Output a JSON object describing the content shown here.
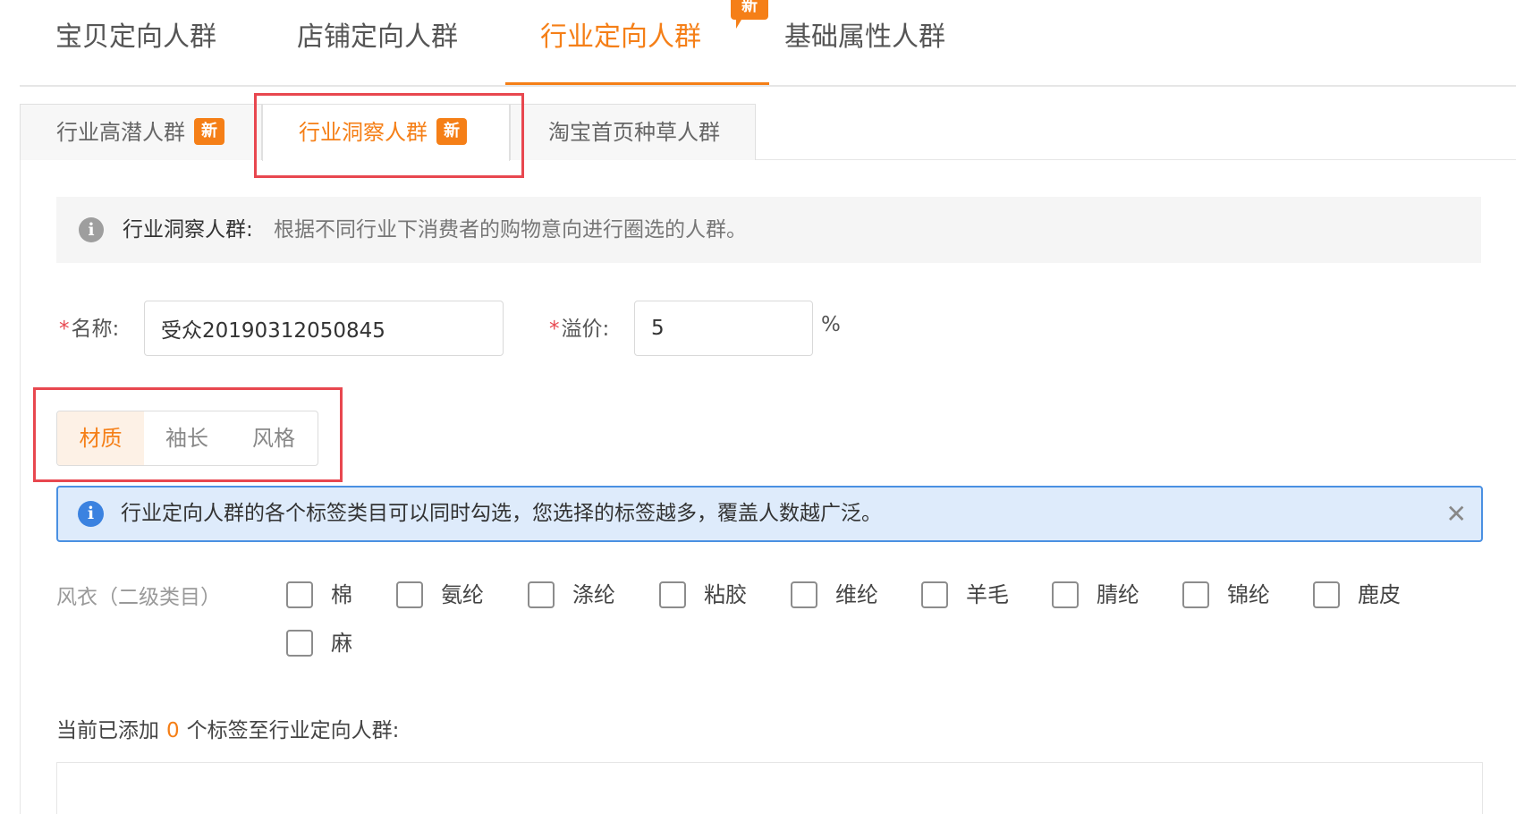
{
  "top_tabs": [
    {
      "label": "宝贝定向人群"
    },
    {
      "label": "店铺定向人群"
    },
    {
      "label": "行业定向人群",
      "badge": "新"
    },
    {
      "label": "基础属性人群"
    }
  ],
  "sub_tabs": [
    {
      "label": "行业高潜人群",
      "badge": "新"
    },
    {
      "label": "行业洞察人群",
      "badge": "新"
    },
    {
      "label": "淘宝首页种草人群"
    }
  ],
  "description": {
    "label": "行业洞察人群:",
    "text": "根据不同行业下消费者的购物意向进行圈选的人群。"
  },
  "form": {
    "required_mark": "*",
    "name_label": "名称:",
    "name_value": "受众20190312050845",
    "premium_label": "溢价:",
    "premium_value": "5",
    "premium_unit": "%"
  },
  "segments": [
    "材质",
    "袖长",
    "风格"
  ],
  "alert": {
    "icon": "i",
    "text": "行业定向人群的各个标签类目可以同时勾选，您选择的标签越多，覆盖人数越广泛。",
    "close": "✕"
  },
  "category": {
    "label": "风衣（二级类目）",
    "options": [
      "棉",
      "氨纶",
      "涤纶",
      "粘胶",
      "维纶",
      "羊毛",
      "腈纶",
      "锦纶",
      "鹿皮",
      "麻"
    ]
  },
  "added": {
    "prefix": "当前已添加",
    "count": "0",
    "suffix": "个标签至行业定向人群:"
  },
  "colors": {
    "accent": "#f57f17",
    "highlight": "#e8474f",
    "info": "#3b82e0"
  }
}
